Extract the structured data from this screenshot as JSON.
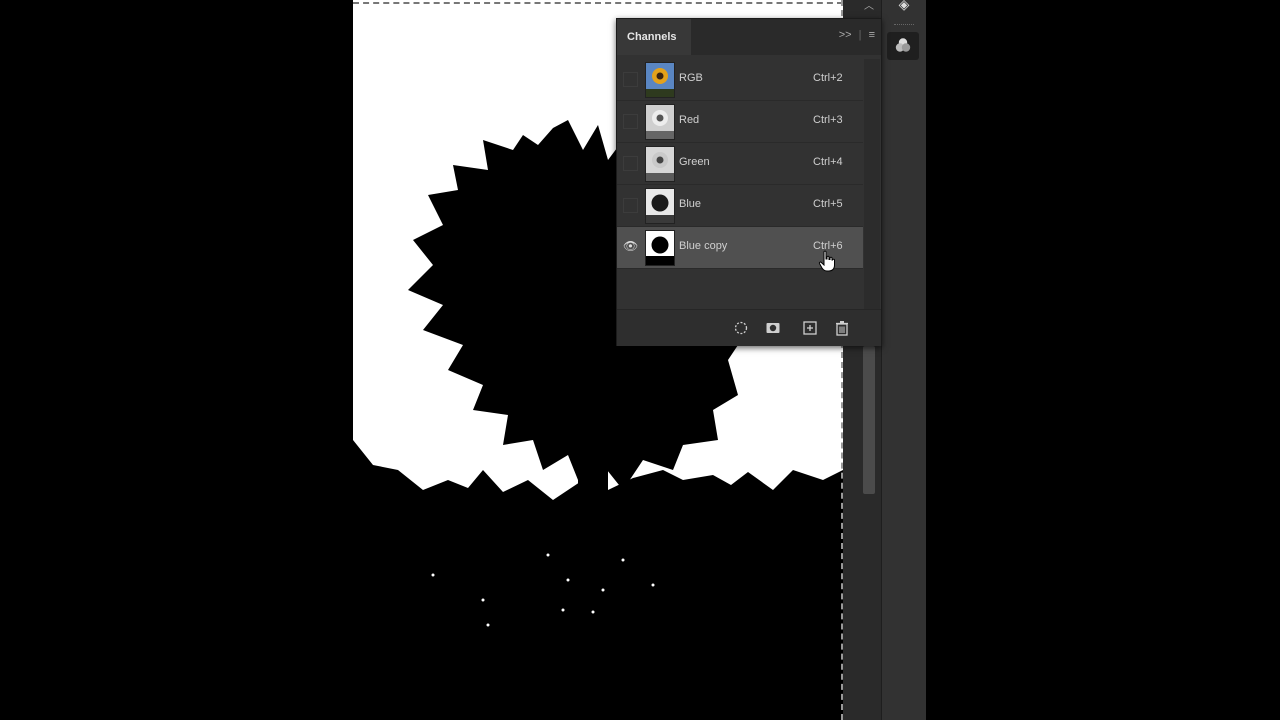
{
  "panel": {
    "title": "Channels",
    "menu_glyph": "≡",
    "collapse_glyph": ">>"
  },
  "channels": [
    {
      "name": "RGB",
      "shortcut": "Ctrl+2",
      "thumb": "color",
      "visible": false,
      "selected": false
    },
    {
      "name": "Red",
      "shortcut": "Ctrl+3",
      "thumb": "light",
      "visible": false,
      "selected": false
    },
    {
      "name": "Green",
      "shortcut": "Ctrl+4",
      "thumb": "light",
      "visible": false,
      "selected": false
    },
    {
      "name": "Blue",
      "shortcut": "Ctrl+5",
      "thumb": "mid",
      "visible": false,
      "selected": false
    },
    {
      "name": "Blue copy",
      "shortcut": "Ctrl+6",
      "thumb": "mask",
      "visible": true,
      "selected": true
    }
  ],
  "footer_icons": [
    "load-selection-icon",
    "save-mask-icon",
    "new-channel-icon",
    "delete-icon"
  ],
  "colors": {
    "panel_bg": "#323232",
    "selected_row": "#505050",
    "text": "#d0d0d0"
  }
}
